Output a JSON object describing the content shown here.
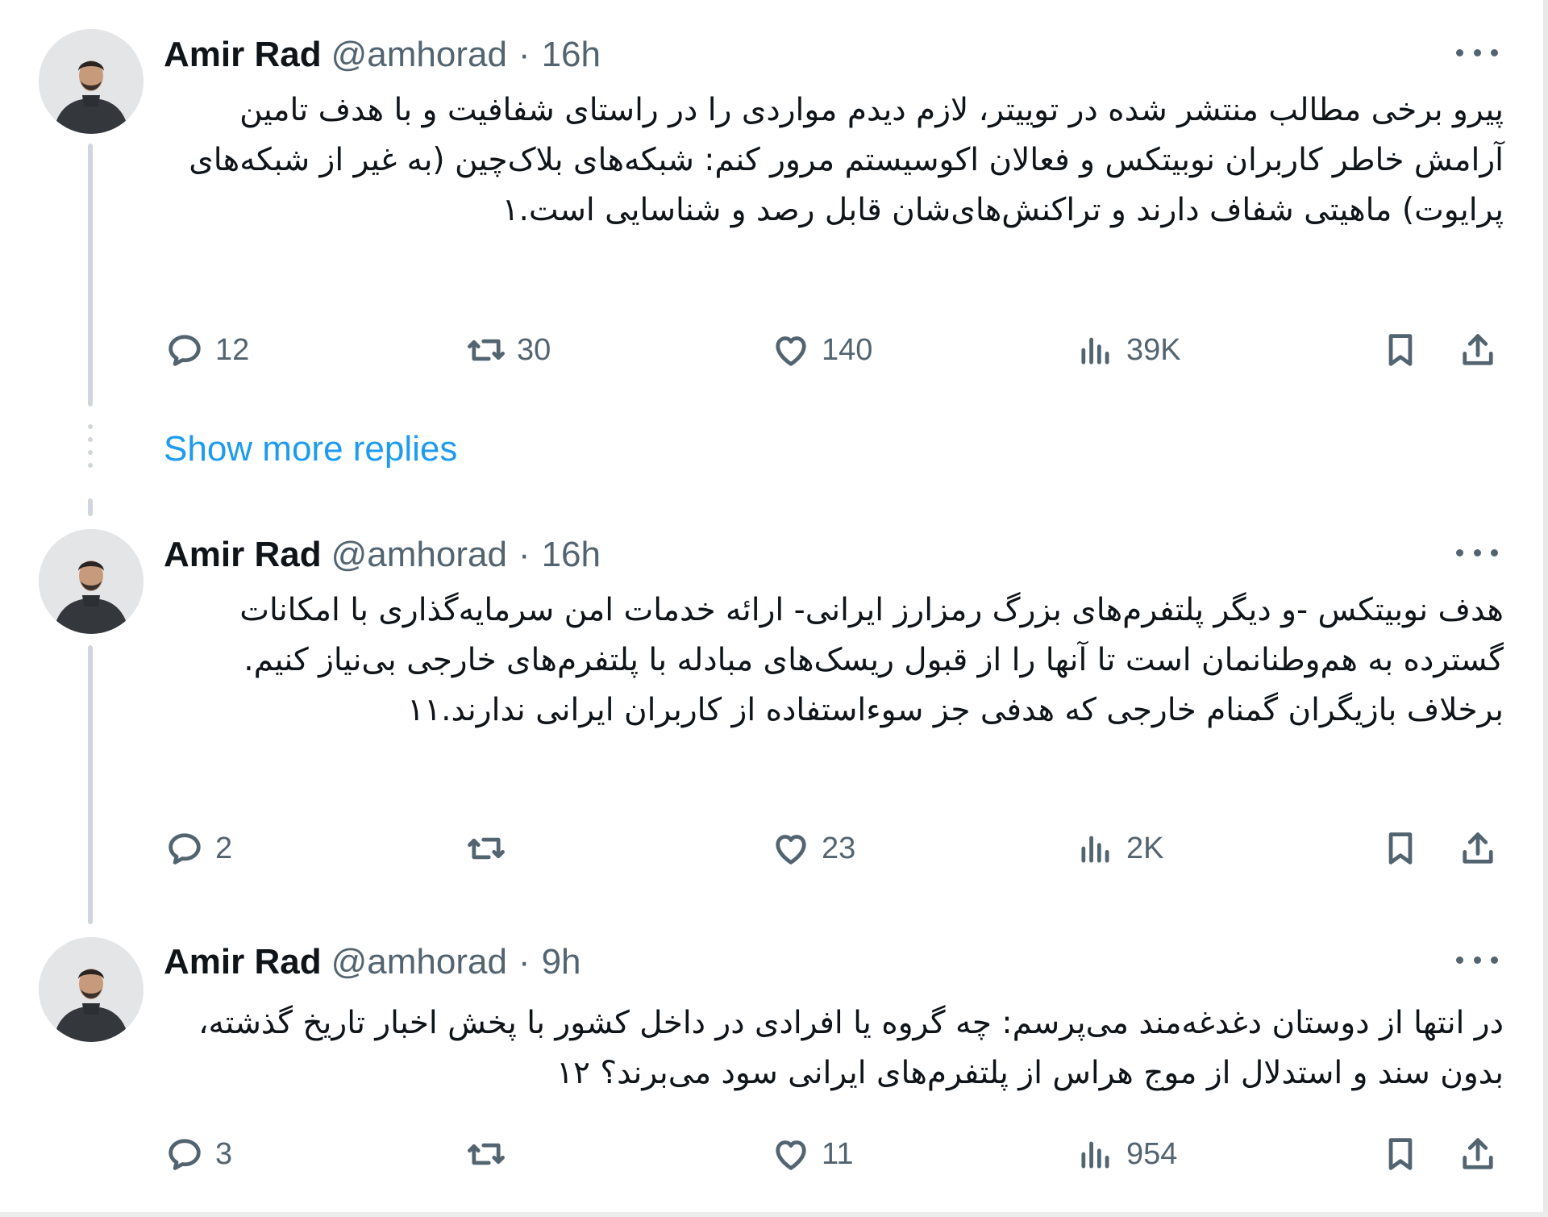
{
  "tweets": [
    {
      "author": "Amir Rad",
      "handle": "@amhorad",
      "separator": "·",
      "time": "16h",
      "text": "پیرو برخی مطالب منتشر شده در توییتر، لازم دیدم مواردی را در راستای شفافیت و با هدف تامین آرامش خاطر کاربران نوبیتکس و فعالان اکوسیستم مرور کنم: شبکه‌های بلاک‌چین (به غیر از شبکه‌های پرایوت) ماهیتی شفاف دارند و تراکنش‌های‌شان قابل رصد و شناسایی است.۱",
      "replies": "12",
      "retweets": "30",
      "likes": "140",
      "views": "39K"
    },
    {
      "author": "Amir Rad",
      "handle": "@amhorad",
      "separator": "·",
      "time": "16h",
      "text": "هدف نوبیتکس -و دیگر پلتفرم‌های بزرگ رمزارز ایرانی- ارائه خدمات امن سرمایه‌گذاری با امکانات گسترده به هم‌وطنانمان است تا آنها را از قبول ریسک‌های مبادله با پلتفرم‌های خارجی بی‌نیاز کنیم. برخلاف بازیگران گمنام خارجی که هدفی جز سوء‌استفاده از کاربران ایرانی ندارند.۱۱",
      "replies": "2",
      "retweets": "",
      "likes": "23",
      "views": "2K"
    },
    {
      "author": "Amir Rad",
      "handle": "@amhorad",
      "separator": "·",
      "time": "9h",
      "text": "در انتها از دوستان دغدغه‌مند می‌پرسم: چه گروه یا افرادی در داخل کشور با پخش اخبار تاریخ گذشته، بدون سند و استدلال از موج هراس از پلتفرم‌های ایرانی سود می‌برند؟ ۱۲",
      "replies": "3",
      "retweets": "",
      "likes": "11",
      "views": "954"
    }
  ],
  "show_more_replies": "Show more replies",
  "colors": {
    "text": "#0f1419",
    "secondary": "#536471",
    "link": "#1d9bf0",
    "thread_line": "#d0d6dc"
  },
  "icons": [
    "reply-icon",
    "retweet-icon",
    "like-icon",
    "views-icon",
    "bookmark-icon",
    "share-icon",
    "more-icon"
  ]
}
